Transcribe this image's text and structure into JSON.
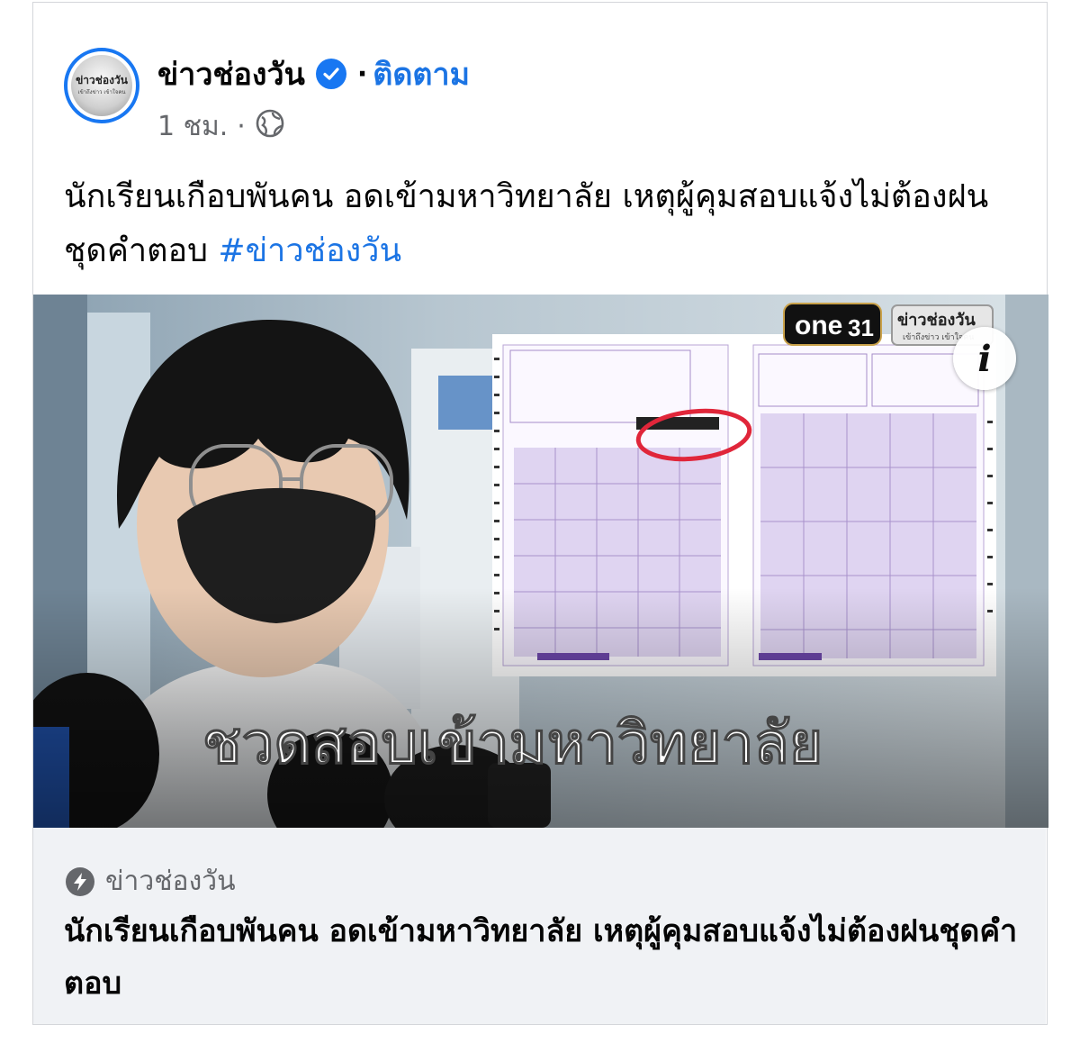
{
  "post": {
    "page_name": "ข่าวช่องวัน",
    "follow_label": "ติดตาม",
    "time": "1 ชม.",
    "avatar_text": "ข่าวช่องวัน",
    "avatar_sub": "เข้าถึงข่าว เข้าใจคน",
    "text": "นักเรียนเกือบพันคน อดเข้ามหาวิทยาลัย เหตุผู้คุมสอบแจ้งไม่ต้องฝนชุดคำตอบ ",
    "hashtag": "#ข่าวช่องวัน"
  },
  "media": {
    "headline": "ชวดสอบเข้ามหาวิทยาลัย",
    "channel_logo": "one31",
    "channel_number": "31",
    "news_logo": "ข่าวช่องวัน",
    "news_logo_sub": "เข้าถึงข่าว เข้าใจคน",
    "info_icon": "i"
  },
  "link": {
    "source": "ข่าวช่องวัน",
    "title": "นักเรียนเกือบพันคน อดเข้ามหาวิทยาลัย เหตุผู้คุมสอบแจ้งไม่ต้องฝนชุดคำตอบ"
  },
  "colors": {
    "accent": "#1877f2",
    "link_blue": "#1b74e4",
    "muted": "#65676b",
    "link_bg": "#f0f2f5"
  },
  "icons": [
    "verified-badge-icon",
    "globe-icon",
    "info-icon",
    "bolt-icon"
  ]
}
